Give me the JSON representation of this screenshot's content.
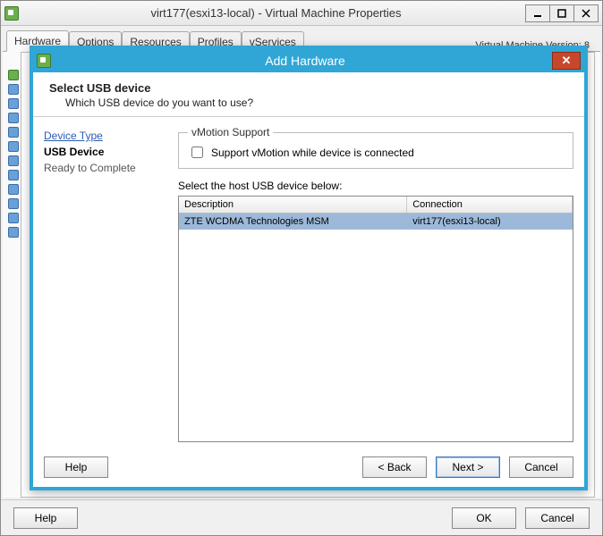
{
  "window": {
    "title": "virt177(esxi13-local) - Virtual Machine Properties",
    "version_label": "Virtual Machine Version: 8",
    "tabs": [
      "Hardware",
      "Options",
      "Resources",
      "Profiles",
      "vServices"
    ],
    "active_tab": "Hardware",
    "help_label": "Help",
    "ok_label": "OK",
    "cancel_label": "Cancel"
  },
  "dialog": {
    "title": "Add Hardware",
    "header_title": "Select USB device",
    "header_sub": "Which USB device do you want to use?",
    "steps": {
      "device_type": "Device Type",
      "usb_device": "USB Device",
      "ready": "Ready to Complete"
    },
    "vmotion": {
      "legend": "vMotion Support",
      "label": "Support vMotion while device is connected"
    },
    "select_label": "Select the host USB device below:",
    "columns": {
      "description": "Description",
      "connection": "Connection"
    },
    "rows": [
      {
        "description": "ZTE WCDMA Technologies MSM",
        "connection": "virt177(esxi13-local)",
        "selected": true
      }
    ],
    "buttons": {
      "help": "Help",
      "back": "< Back",
      "next": "Next >",
      "cancel": "Cancel"
    }
  }
}
